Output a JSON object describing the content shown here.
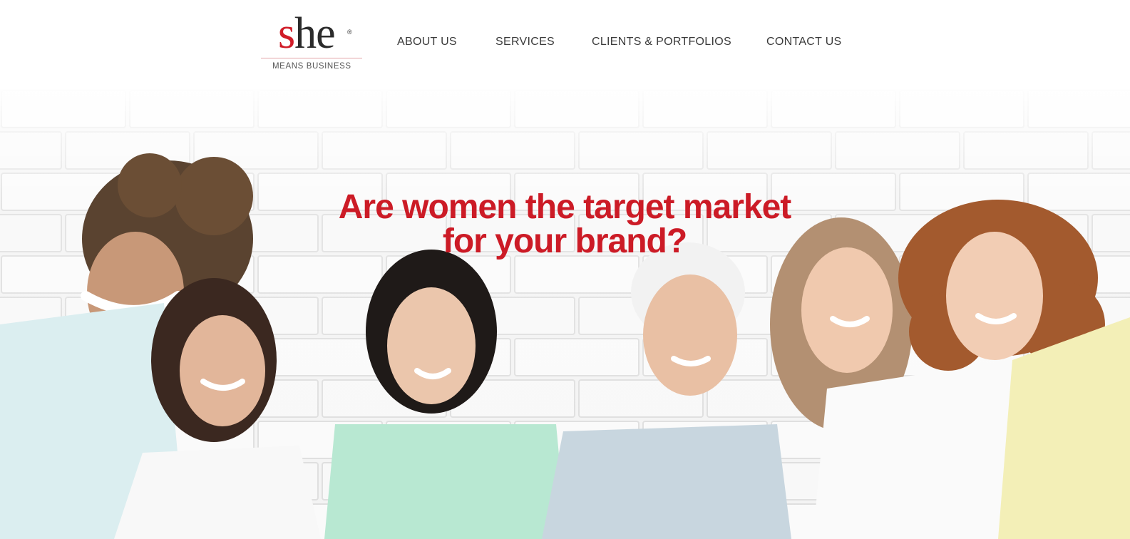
{
  "brand": {
    "logo_word_first": "s",
    "logo_word_rest": "he",
    "logo_registered": "®",
    "tagline": "MEANS BUSINESS",
    "accent_color": "#cc1b26"
  },
  "nav": {
    "items": [
      {
        "label": "ABOUT US"
      },
      {
        "label": "SERVICES"
      },
      {
        "label": "CLIENTS & PORTFOLIOS"
      },
      {
        "label": "CONTACT US"
      }
    ]
  },
  "hero": {
    "heading_line1": "Are women the target market",
    "heading_line2": "for your brand?",
    "image": "group-of-six-smiling-women-photo"
  }
}
